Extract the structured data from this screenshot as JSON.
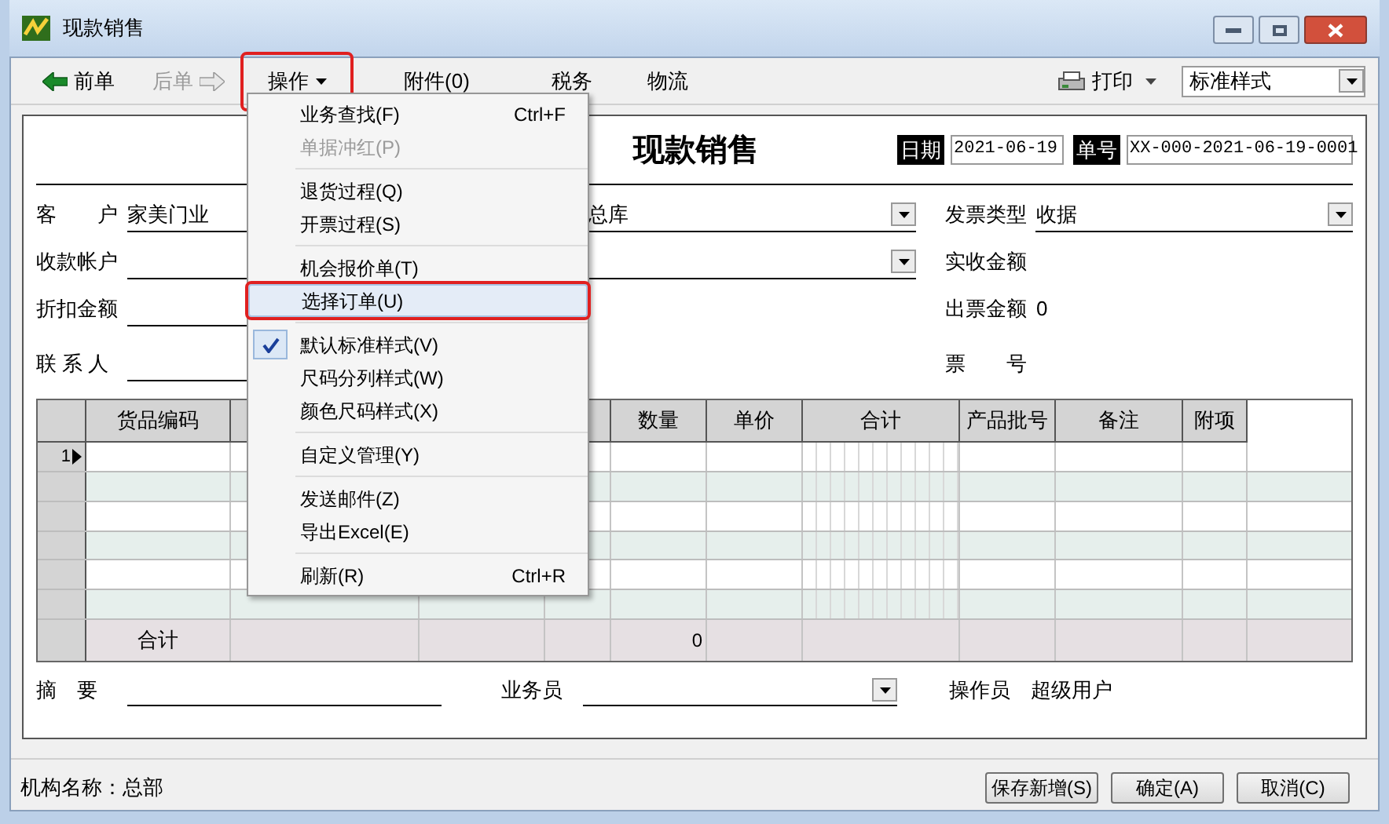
{
  "window": {
    "title": "现款销售"
  },
  "toolbar": {
    "items": [
      {
        "kind": "back",
        "label": "前单",
        "disabled": false,
        "highlighted": false
      },
      {
        "kind": "forward",
        "label": "后单",
        "disabled": true,
        "highlighted": false
      },
      {
        "kind": "menu",
        "label": "操作",
        "disabled": false,
        "highlighted": true
      },
      {
        "kind": "plain",
        "label": "附件(0)",
        "disabled": false,
        "highlighted": false
      },
      {
        "kind": "plain",
        "label": "税务",
        "disabled": false,
        "highlighted": false
      },
      {
        "kind": "plain",
        "label": "物流",
        "disabled": false,
        "highlighted": false
      }
    ],
    "print": "打印",
    "style_select": "标准样式"
  },
  "form": {
    "title": "现款销售",
    "date_label": "日期",
    "date": "2021-06-19",
    "number_label": "单号",
    "number": "XX-000-2021-06-19-0001",
    "fields": [
      [
        {
          "label": "客　　户",
          "value": "家美门业",
          "kind": "text"
        },
        {
          "value": "总库",
          "kind": "dropdown"
        },
        {
          "label": "发票类型",
          "value": "收据",
          "kind": "dropdown"
        }
      ],
      [
        {
          "label": "收款帐户",
          "kind": "text"
        },
        {
          "kind": "dropdown"
        },
        {
          "label": "实收金额",
          "kind": "plain"
        }
      ],
      [
        {
          "label": "折扣金额",
          "kind": "text"
        },
        {
          "kind": "none"
        },
        {
          "label": "出票金额",
          "value": "0",
          "kind": "plain"
        }
      ],
      [
        {
          "label": "联 系 人",
          "kind": "text"
        },
        {
          "kind": "none"
        },
        {
          "label": "票　　号",
          "kind": "plain"
        }
      ]
    ]
  },
  "table": {
    "columns": [
      "货品编码",
      "",
      "",
      "",
      "数量",
      "单价",
      "合计",
      "产品批号",
      "备注",
      "附项"
    ],
    "rows": [
      {
        "header": "1",
        "current": true
      },
      {
        "header": "",
        "current": false
      },
      {
        "header": "",
        "current": false
      },
      {
        "header": "",
        "current": false
      },
      {
        "header": "",
        "current": false
      },
      {
        "header": "",
        "current": false
      }
    ],
    "total_row": {
      "label": "合计",
      "quantity": "0"
    }
  },
  "footer": {
    "summary_label": "摘　要",
    "salesperson_label": "业务员",
    "operator_label": "操作员",
    "operator": "超级用户"
  },
  "status_bar": {
    "org": "机构名称：总部",
    "buttons": [
      "保存新增(S)",
      "确定(A)",
      "取消(C)"
    ]
  },
  "menu": {
    "groups": [
      [
        {
          "label": "业务查找(F)",
          "shortcut": "Ctrl+F",
          "disabled": false,
          "checked": false,
          "selected": false
        },
        {
          "label": "单据冲红(P)",
          "disabled": true,
          "checked": false,
          "selected": false
        }
      ],
      [
        {
          "label": "退货过程(Q)",
          "disabled": false,
          "checked": false,
          "selected": false
        },
        {
          "label": "开票过程(S)",
          "disabled": false,
          "checked": false,
          "selected": false
        }
      ],
      [
        {
          "label": "机会报价单(T)",
          "disabled": false,
          "checked": false,
          "selected": false
        },
        {
          "label": "选择订单(U)",
          "disabled": false,
          "checked": false,
          "selected": true
        }
      ],
      [
        {
          "label": "默认标准样式(V)",
          "disabled": false,
          "checked": true,
          "selected": false
        },
        {
          "label": "尺码分列样式(W)",
          "disabled": false,
          "checked": false,
          "selected": false
        },
        {
          "label": "颜色尺码样式(X)",
          "disabled": false,
          "checked": false,
          "selected": false
        }
      ],
      [
        {
          "label": "自定义管理(Y)",
          "disabled": false,
          "checked": false,
          "selected": false
        }
      ],
      [
        {
          "label": "发送邮件(Z)",
          "disabled": false,
          "checked": false,
          "selected": false
        },
        {
          "label": "导出Excel(E)",
          "disabled": false,
          "checked": false,
          "selected": false
        }
      ],
      [
        {
          "label": "刷新(R)",
          "shortcut": "Ctrl+R",
          "disabled": false,
          "checked": false,
          "selected": false
        }
      ]
    ]
  }
}
